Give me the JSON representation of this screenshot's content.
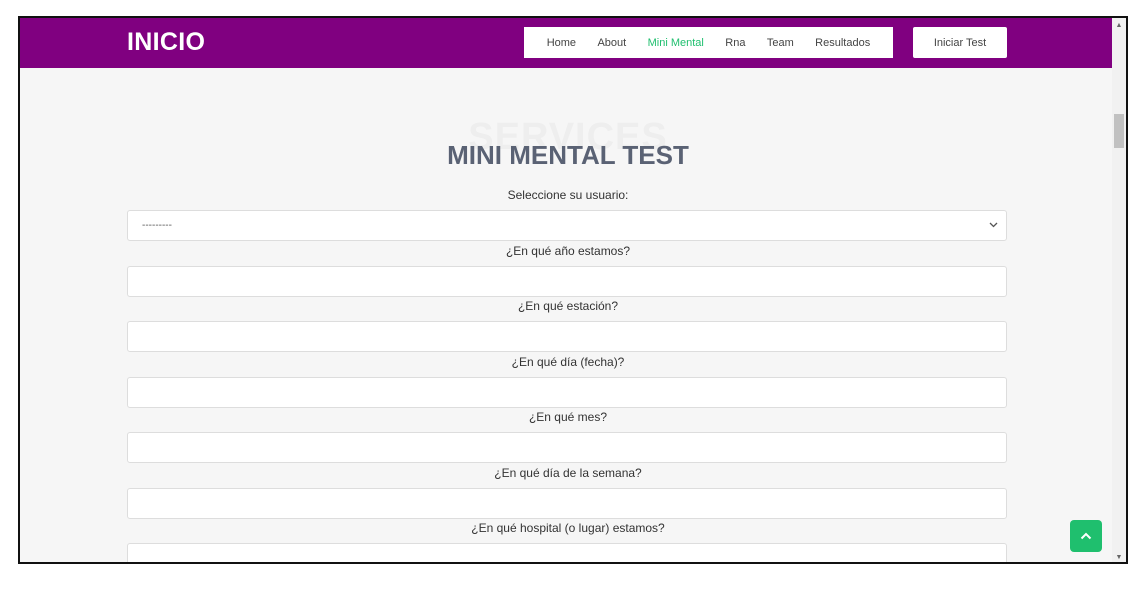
{
  "header": {
    "brand": "INICIO",
    "nav": [
      "Home",
      "About",
      "Mini Mental",
      "Rna",
      "Team",
      "Resultados"
    ],
    "active_nav": "Mini Mental",
    "cta": "Iniciar Test"
  },
  "main": {
    "ghost_title": "SERVICES",
    "title": "MINI MENTAL TEST",
    "user_label": "Seleccione su usuario:",
    "user_select_value": "---------",
    "questions": [
      "¿En qué año estamos?",
      "¿En qué estación?",
      "¿En qué día (fecha)?",
      "¿En qué mes?",
      "¿En qué día de la semana?",
      "¿En qué hospital (o lugar) estamos?"
    ]
  },
  "colors": {
    "header_bg": "#800080",
    "accent": "#1fbf6e",
    "title": "#5a6274"
  },
  "icons": {
    "select": "chevron-down-icon",
    "back_to_top": "chevron-up-icon"
  }
}
